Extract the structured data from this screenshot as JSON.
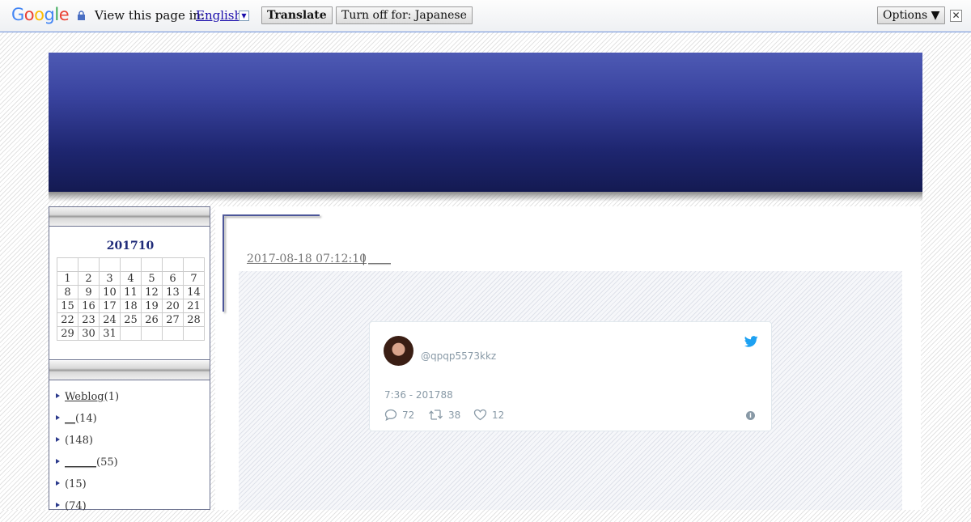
{
  "translate_bar": {
    "logo": "Google",
    "prompt": "View this page in:",
    "language": "English",
    "translate_label": "Translate",
    "turn_off_label": "Turn off for: Japanese",
    "options_label": "Options ▼",
    "close_label": "✕"
  },
  "sidebar": {
    "calendar": {
      "title": "201710",
      "weeks": [
        [
          "",
          "",
          "",
          "",
          "",
          "",
          ""
        ],
        [
          "1",
          "2",
          "3",
          "4",
          "5",
          "6",
          "7"
        ],
        [
          "8",
          "9",
          "10",
          "11",
          "12",
          "13",
          "14"
        ],
        [
          "15",
          "16",
          "17",
          "18",
          "19",
          "20",
          "21"
        ],
        [
          "22",
          "23",
          "24",
          "25",
          "26",
          "27",
          "28"
        ],
        [
          "29",
          "30",
          "31",
          "",
          "",
          "",
          ""
        ]
      ]
    },
    "categories": [
      {
        "link": "Weblog",
        "count": "(1)"
      },
      {
        "link": "__",
        "count": "(14)"
      },
      {
        "link": "",
        "count": "(148)"
      },
      {
        "link": "______",
        "count": "(55)"
      },
      {
        "link": "",
        "count": "(15)"
      },
      {
        "link": "",
        "count": "(74)"
      }
    ]
  },
  "entry": {
    "date": "2017-08-18 07:12:10",
    "separator": "|",
    "category": "____"
  },
  "tweet": {
    "handle": "@qpqp5573kkz",
    "time": "7:36 - 201788",
    "replies": "72",
    "retweets": "38",
    "likes": "12",
    "info": "i"
  },
  "colors": {
    "banner_top": "#4e5ab4",
    "banner_bottom": "#141a52",
    "accent": "#1e2a78",
    "twitter_blue": "#1da1f2"
  },
  "icons": [
    "lock-icon",
    "dropdown-arrow-icon",
    "close-icon",
    "twitter-bird-icon",
    "reply-icon",
    "retweet-icon",
    "like-icon",
    "info-icon",
    "bullet-icon"
  ]
}
